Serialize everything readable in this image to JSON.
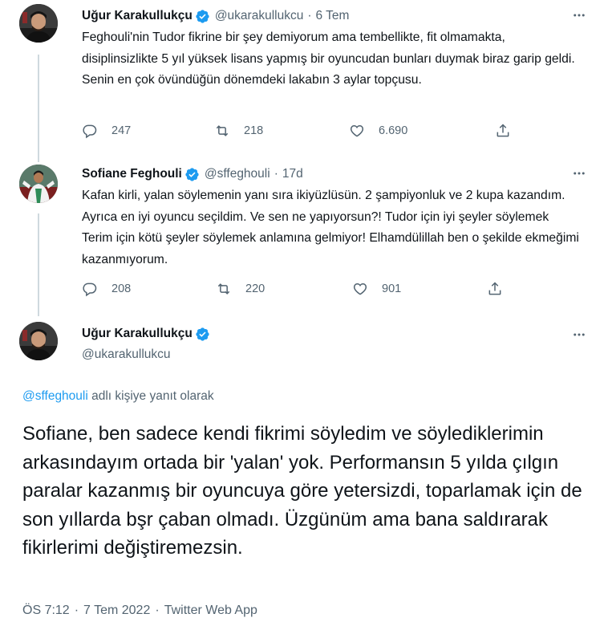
{
  "tweets": [
    {
      "display_name": "Uğur Karakullukçu",
      "handle": "@ukarakullukcu",
      "separator": "·",
      "time": "6 Tem",
      "text": "Feghouli'nin Tudor fikrine bir şey demiyorum ama tembellikte, fit olmamakta, disiplinsizlikte 5 yıl yüksek lisans yapmış bir oyuncudan bunları duymak biraz garip geldi. Senin en çok övündüğün dönemdeki lakabın 3 aylar topçusu.",
      "replies": "247",
      "retweets": "218",
      "likes": "6.690"
    },
    {
      "display_name": "Sofiane Feghouli",
      "handle": "@sffeghouli",
      "separator": "·",
      "time": "17d",
      "text": "Kafan kirli, yalan söylemenin yanı sıra ikiyüzlüsün. 2 şampiyonluk ve 2 kupa kazandım. Ayrıca en iyi oyuncu seçildim. Ve sen ne yapıyorsun?! Tudor için iyi şeyler söylemek Terim için kötü şeyler söylemek anlamına gelmiyor! Elhamdülillah ben o şekilde ekmeğimi kazanmıyorum.",
      "replies": "208",
      "retweets": "220",
      "likes": "901"
    }
  ],
  "main_tweet": {
    "display_name": "Uğur Karakullukçu",
    "handle": "@ukarakullukcu",
    "reply_to_mention": "@sffeghouli",
    "reply_to_suffix": " adlı kişiye yanıt olarak",
    "text": "Sofiane, ben sadece kendi fikrimi söyledim ve söylediklerimin arkasındayım ortada bir 'yalan' yok. Performansın 5 yılda çılgın paralar kazanmış bir oyuncuya göre yetersizdi, toparlamak için de son yıllarda bşr çaban olmadı. Üzgünüm ama bana saldırarak fikirlerimi değiştiremezsin.",
    "time": "ÖS 7:12",
    "date": "7 Tem 2022",
    "source": "Twitter Web App",
    "separator": "·"
  },
  "colors": {
    "accent": "#1d9bf0",
    "muted": "#536471",
    "text": "#0f1419",
    "thread_line": "#cfd9de"
  },
  "icons": [
    "verified-badge-icon",
    "more-icon",
    "reply-icon",
    "retweet-icon",
    "like-icon",
    "share-icon"
  ]
}
